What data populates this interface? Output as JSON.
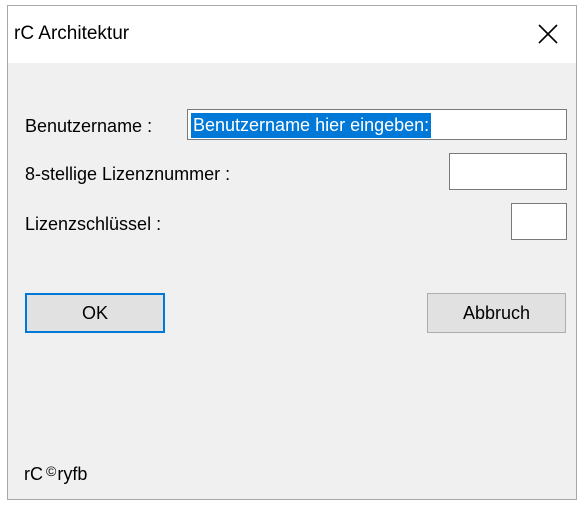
{
  "window": {
    "title": "rC Architektur",
    "close_glyph": "close-icon"
  },
  "form": {
    "username_label": "Benutzername :",
    "username_value": "Benutzername hier eingeben:",
    "license_number_label": "8-stellige Lizenznummer :",
    "license_number_value": "",
    "license_key_label": "Lizenzschlüssel :",
    "license_key_value": ""
  },
  "buttons": {
    "ok_label": "OK",
    "cancel_label": "Abbruch"
  },
  "footer": {
    "prefix": "rC",
    "symbol": "©",
    "suffix": "ryfb"
  },
  "colors": {
    "selection": "#0078d7",
    "dialog_background": "#f0f0f0"
  }
}
